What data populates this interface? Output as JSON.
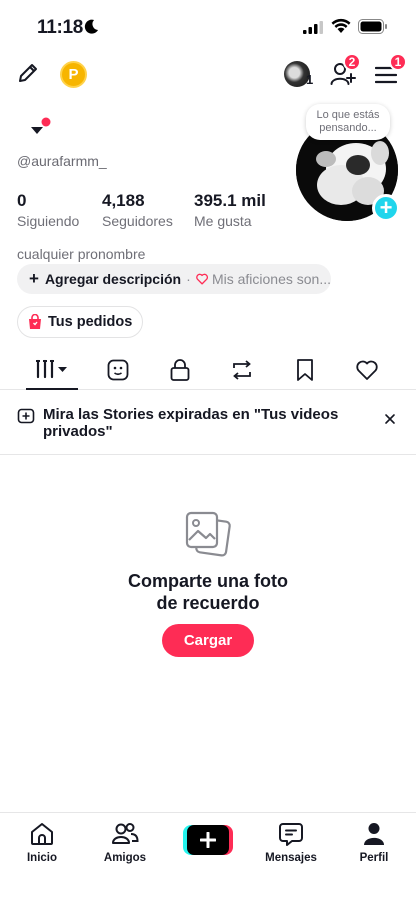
{
  "status_bar": {
    "time": "11:18"
  },
  "top_bar": {
    "coin_letter": "P",
    "friend_avatar_count": "1",
    "add_friends_badge": "2",
    "menu_badge": "1"
  },
  "profile": {
    "username": "@aurafarmm_",
    "bubble_text": "Lo que estás pensando...",
    "stats": [
      {
        "value": "0",
        "label": "Siguiendo"
      },
      {
        "value": "4,188",
        "label": "Seguidores"
      },
      {
        "value": "395.1 mil",
        "label": "Me gusta"
      }
    ],
    "pronoun": "cualquier pronombre",
    "add_description": "Agregar descripción",
    "hobbies_placeholder": "Mis aficiones son...",
    "orders_label": "Tus pedidos"
  },
  "tabs": [
    "videos-grid",
    "stickers",
    "private",
    "reposts",
    "favorites",
    "liked"
  ],
  "banner": {
    "text": "Mira las Stories expiradas en \"Tus videos privados\""
  },
  "empty_state": {
    "title_line1": "Comparte una foto",
    "title_line2": "de recuerdo",
    "upload_label": "Cargar"
  },
  "bottom_nav": {
    "home": "Inicio",
    "friends": "Amigos",
    "messages": "Mensajes",
    "profile": "Perfil"
  },
  "colors": {
    "accent": "#fe2c55",
    "cyan": "#20d5ec",
    "coin": "#f7b500"
  }
}
